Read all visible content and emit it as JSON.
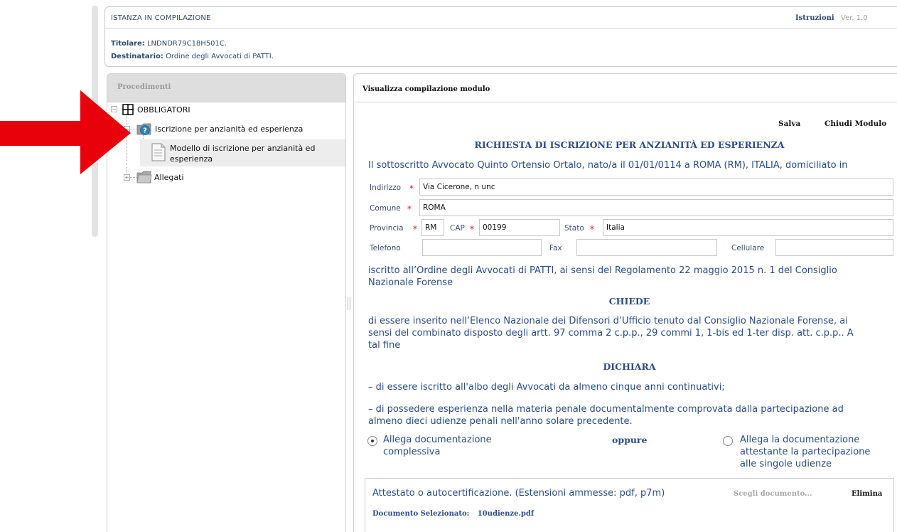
{
  "header": {
    "title": "ISTANZA IN COMPILAZIONE",
    "istruzioni": "Istruzioni",
    "version": "Ver. 1.0",
    "titolare_label": "Titolare:",
    "titolare_value": "LNDNDR79C18H501C.",
    "destinatario_label": "Destinatario:",
    "destinatario_value": "Ordine degli Avvocati di PATTI."
  },
  "sidebar": {
    "title": "Procedimenti",
    "tree": {
      "root": "OBBLIGATORI",
      "node": "Iscrizione per anzianità ed esperienza",
      "leaf_line1": "Modello di iscrizione per anzianità ed",
      "leaf_line2": "esperienza",
      "attachments": "Allegati"
    }
  },
  "main": {
    "panel_title": "Visualizza compilazione modulo",
    "save": "Salva",
    "close": "Chiudi Modulo",
    "form_title": "RICHIESTA DI ISCRIZIONE PER ANZIANITÀ ED ESPERIENZA",
    "intro": "Il sottoscritto Avvocato Quinto Ortensio Ortalo, nato/a il 01/01/0114 a ROMA (RM), ITALIA, domiciliato in",
    "fields": {
      "indirizzo_label": "Indirizzo",
      "indirizzo_value": "Via Cicerone, n unc",
      "comune_label": "Comune",
      "comune_value": "ROMA",
      "provincia_label": "Provincia",
      "provincia_value": "RM",
      "cap_label": "CAP",
      "cap_value": "00199",
      "stato_label": "Stato",
      "stato_value": "Italia",
      "telefono_label": "Telefono",
      "telefono_value": "",
      "fax_label": "Fax",
      "fax_value": "",
      "cellulare_label": "Cellulare",
      "cellulare_value": "",
      "required_mark": "*"
    },
    "iscritto_line1": "iscritto all’Ordine degli Avvocati di PATTI, ai sensi del Regolamento 22 maggio 2015 n. 1 del Consiglio",
    "iscritto_line2": "Nazionale Forense",
    "chiede": "CHIEDE",
    "chiede_text_line1": "di essere inserito nell’Elenco Nazionale dei Difensori d’Ufficio tenuto dal Consiglio Nazionale Forense, ai",
    "chiede_text_line2": "sensi del combinato disposto degli artt. 97 comma 2 c.p.p., 29 commi 1, 1-bis ed 1-ter disp. att. c.p.p.. A",
    "chiede_text_line3": "tal fine",
    "dichiara": "DICHIARA",
    "dichiara_item1": "– di essere iscritto all'albo degli Avvocati da almeno cinque anni continuativi;",
    "dichiara_item2_line1": "– di possedere esperienza nella materia penale documentalmente comprovata dalla partecipazione ad",
    "dichiara_item2_line2": "almeno dieci udienze penali nell'anno solare precedente.",
    "option1_line1": "Allega documentazione",
    "option1_line2": "complessiva",
    "oppure": "oppure",
    "option2_line1": "Allega la documentazione",
    "option2_line2": "attestante la partecipazione",
    "option2_line3": "alle singole udienze",
    "attachment": {
      "label": "Attestato o autocertificazione. (Estensioni ammesse: pdf, p7m)",
      "choose": "Scegli documento...",
      "delete": "Elimina",
      "selected_label": "Documento Selezionato:",
      "selected_file": "10udienze.pdf"
    }
  },
  "colors": {
    "accent_blue": "#2a4d86",
    "arrow_red": "#e8000b",
    "required_red": "#d0112b"
  }
}
